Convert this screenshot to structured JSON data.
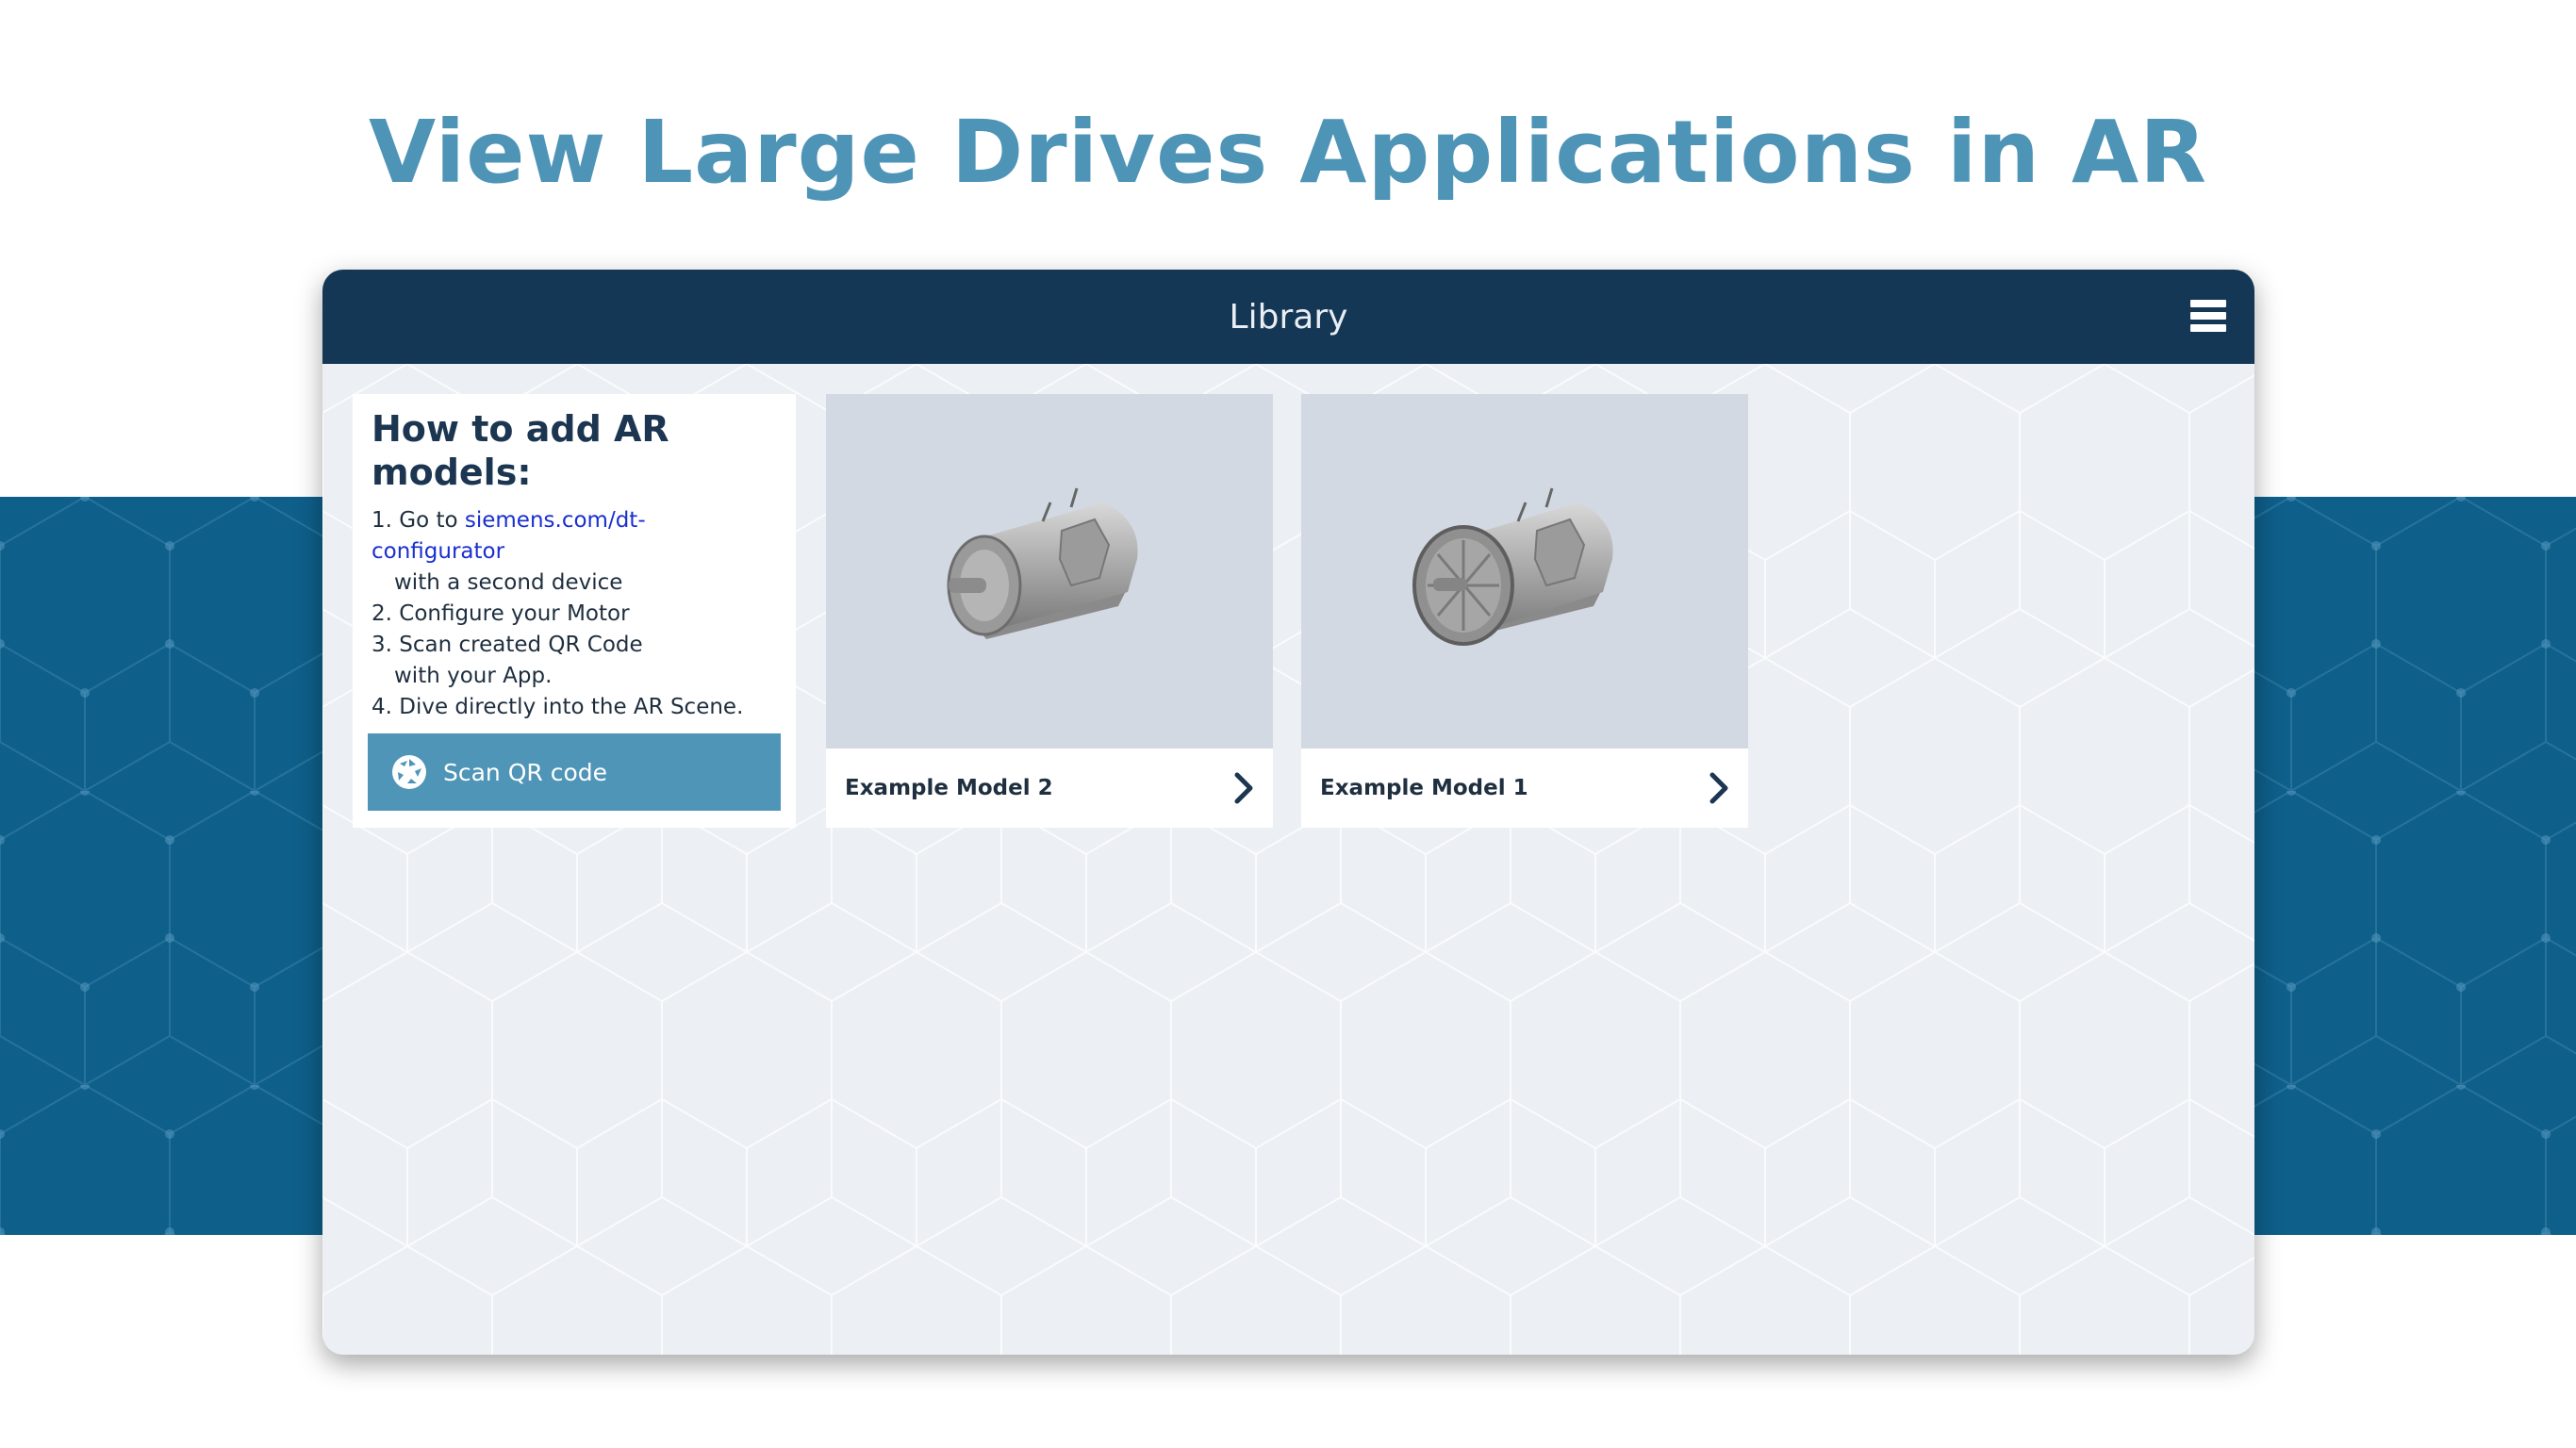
{
  "headline": "View Large Drives Applications in AR",
  "window": {
    "title": "Library",
    "menu_icon": "hamburger-menu-icon"
  },
  "howto": {
    "title": "How to add AR models:",
    "steps": {
      "s1_prefix": "1. Go to ",
      "s1_link": "siemens.com/dt-configurator",
      "s1_cont": "with a second device",
      "s2": "2. Configure your Motor",
      "s3": "3. Scan created QR Code",
      "s3_cont": "with your App.",
      "s4": "4. Dive directly into the AR Scene."
    },
    "scan_button": {
      "label": "Scan QR code",
      "icon": "scan-aperture-icon"
    }
  },
  "models": [
    {
      "name": "Example Model 2",
      "icon": "chevron-right-icon"
    },
    {
      "name": "Example Model 1",
      "icon": "chevron-right-icon"
    }
  ],
  "colors": {
    "headline": "#4e94b6",
    "titlebar": "#153756",
    "band": "#0e5f8a",
    "scan_button": "#4f95b7",
    "link": "#1a2fd0"
  }
}
